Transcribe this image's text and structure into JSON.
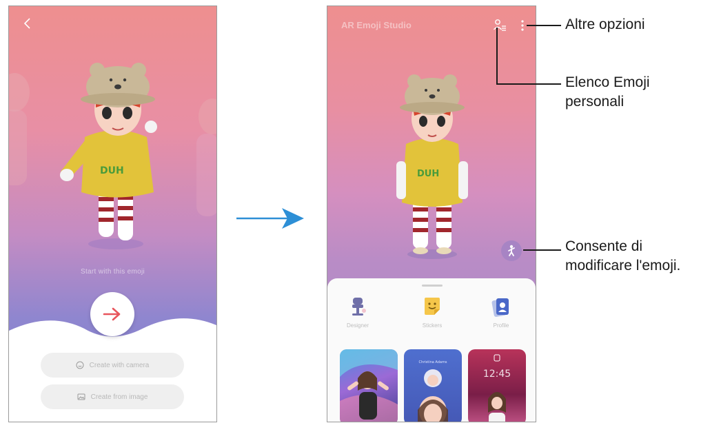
{
  "left_screen": {
    "start_text": "Start with this emoji",
    "buttons": {
      "camera_label": "Create with camera",
      "image_label": "Create from image"
    },
    "icons": [
      "back-icon",
      "arrow-right-icon",
      "smile-icon",
      "image-icon"
    ]
  },
  "right_screen": {
    "app_title": "AR Emoji Studio",
    "modes": [
      {
        "label": "Designer"
      },
      {
        "label": "Stickers"
      },
      {
        "label": "Profile"
      }
    ],
    "thumb_time": "12:45",
    "thumb_profile_name": "Christina Adams",
    "icons": [
      "emoji-list-icon",
      "more-options-icon",
      "edit-emoji-icon"
    ]
  },
  "callouts": {
    "more_options": "Altre opzioni",
    "emoji_list_line1": "Elenco Emoji",
    "emoji_list_line2": "personali",
    "edit_line1": "Consente di",
    "edit_line2": "modificare l'emoji."
  },
  "colors": {
    "accent_arrow": "#e8555c",
    "callout_line": "#1a1a1a",
    "flow_arrow": "#2d8fd6",
    "fab": "#a784c4"
  }
}
